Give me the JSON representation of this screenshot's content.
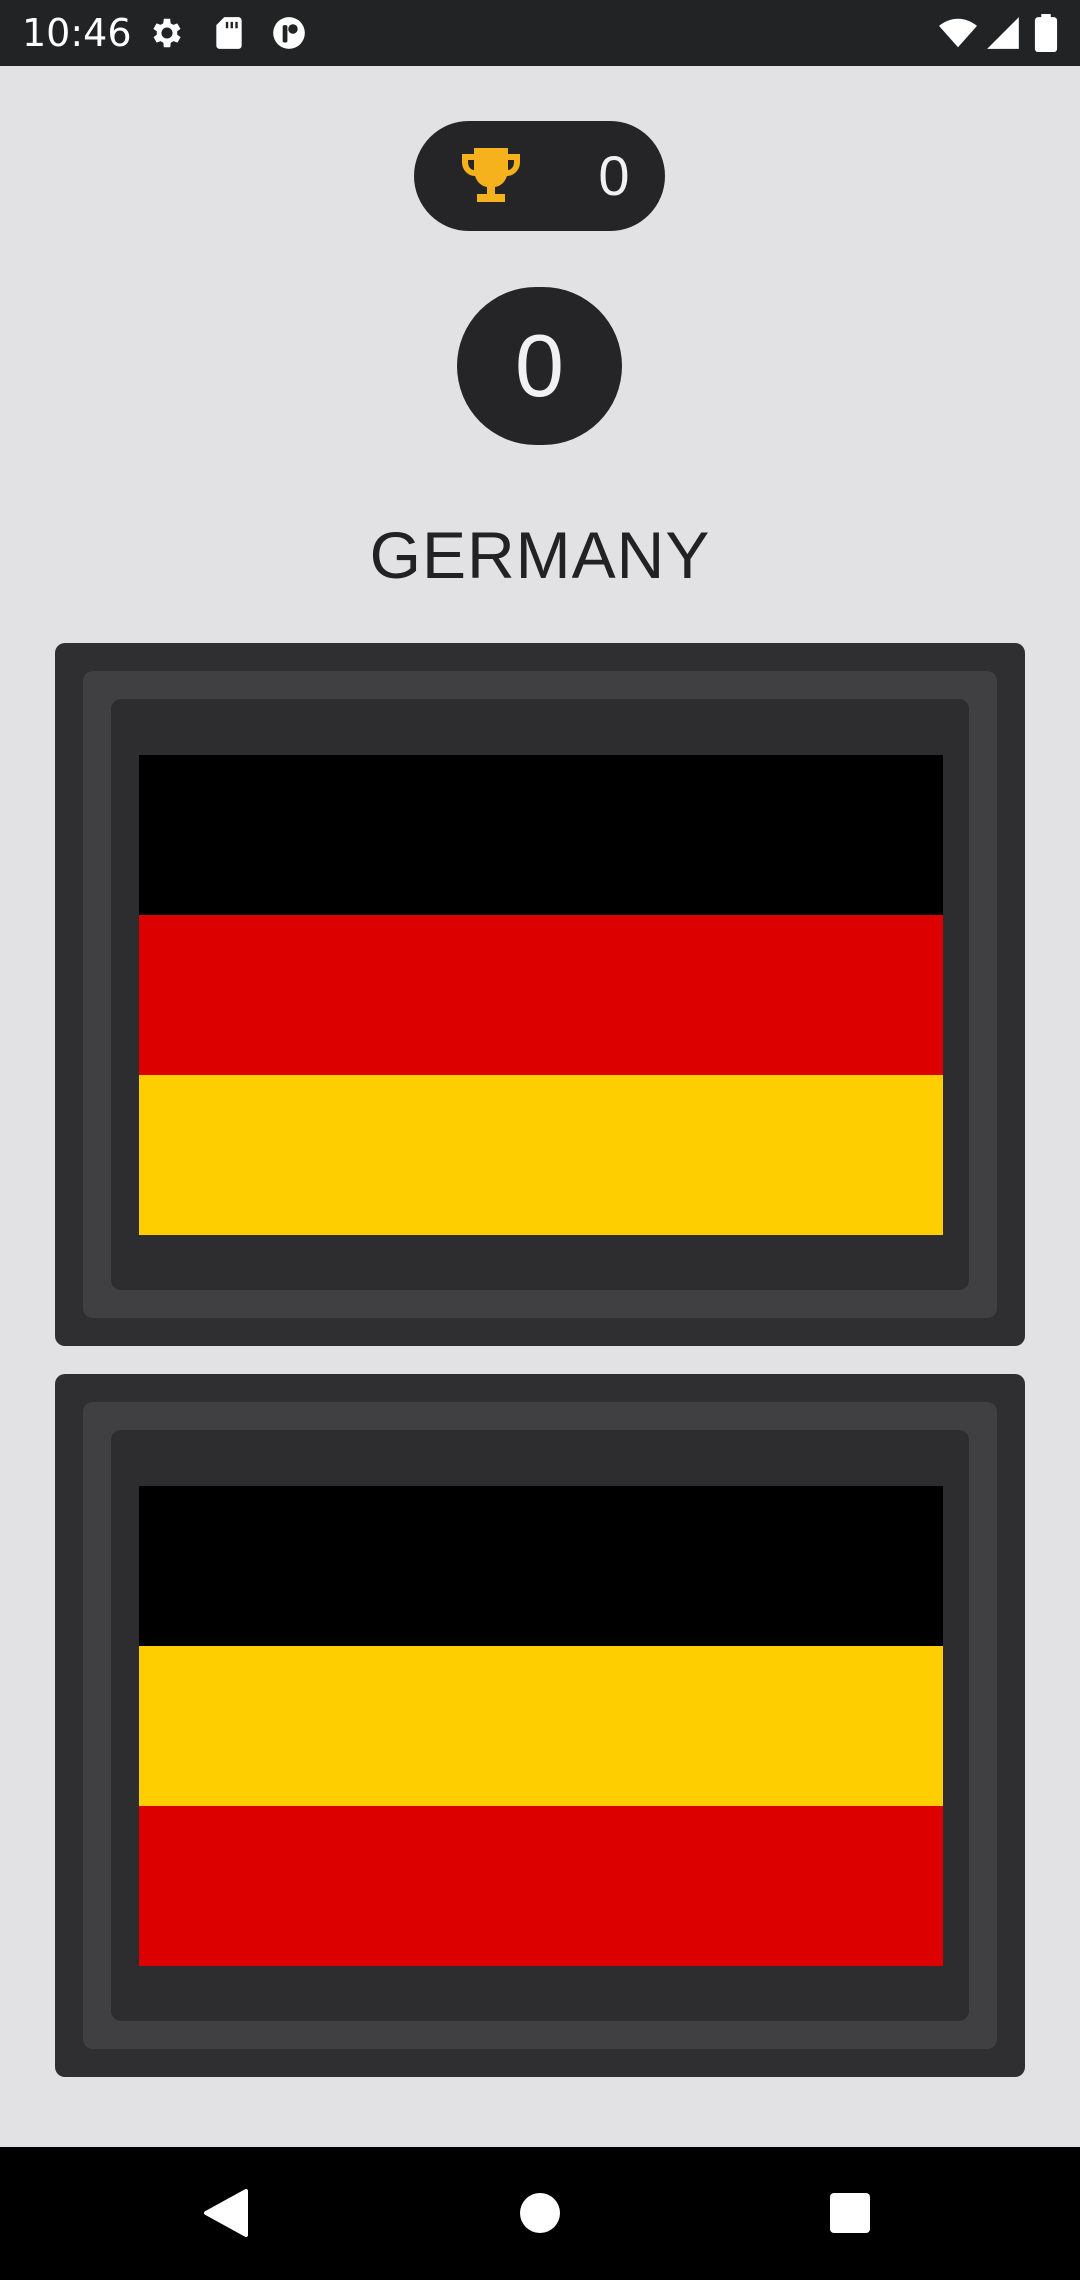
{
  "status_bar": {
    "time": "10:46",
    "icons": [
      "gear-icon",
      "sd-card-icon",
      "app-notification-icon",
      "wifi-icon",
      "signal-icon",
      "battery-icon"
    ]
  },
  "score": {
    "best_icon": "trophy-icon",
    "best_value": "0",
    "current_value": "0"
  },
  "question": {
    "country": "GERMANY"
  },
  "options": [
    {
      "stripes": [
        "#000000",
        "#dd0000",
        "#ffce00"
      ]
    },
    {
      "stripes": [
        "#000000",
        "#ffce00",
        "#dd0000"
      ]
    }
  ],
  "colors": {
    "background": "#e2e2e5",
    "card": "#2f2f32",
    "pill": "#252528",
    "trophy": "#f5b21c"
  },
  "nav_bar": {
    "icons": [
      "back-icon",
      "home-icon",
      "recents-icon"
    ]
  }
}
